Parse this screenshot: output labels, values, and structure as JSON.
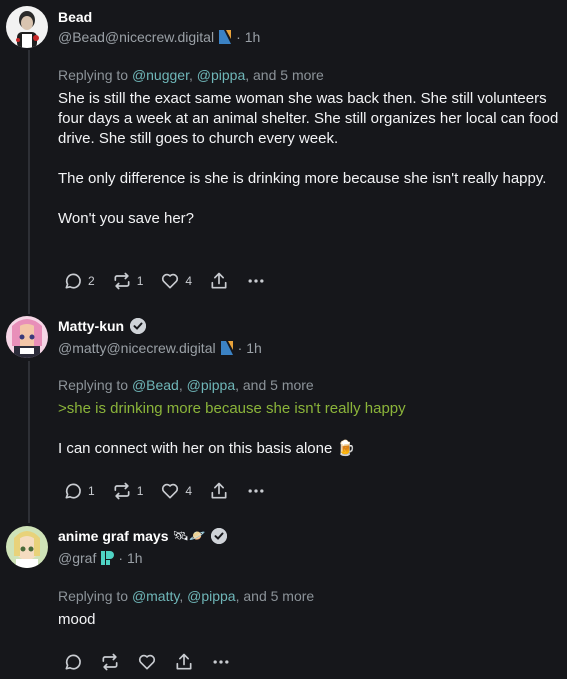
{
  "posts": [
    {
      "name": "Bead",
      "handle": "@Bead@nicecrew.digital",
      "time": "1h",
      "separator": "·",
      "replying_prefix": "Replying to",
      "mentions": [
        "@nugger",
        "@pippa"
      ],
      "replying_more": ", and 5 more",
      "paragraphs": [
        "She is still the exact same woman she was back then. She still volunteers four days a week at an animal shelter. She still organizes her local can food drive. She still goes to church every week.",
        "The only difference is she is drinking more because she isn't really happy.",
        "Won't you save her?"
      ],
      "counts": {
        "replies": "2",
        "reposts": "1",
        "likes": "4"
      },
      "instance_icon": "nicecrew-n-icon"
    },
    {
      "name": "Matty-kun",
      "handle": "@matty@nicecrew.digital",
      "time": "1h",
      "separator": "·",
      "replying_prefix": "Replying to",
      "mentions": [
        "@Bead",
        "@pippa"
      ],
      "replying_more": ", and 5 more",
      "greentext": ">she is drinking more because she isn't really happy",
      "text": "I can connect with her on this basis alone",
      "emoji": "🍺",
      "counts": {
        "replies": "1",
        "reposts": "1",
        "likes": "4"
      },
      "instance_icon": "nicecrew-n-icon",
      "verified": true
    },
    {
      "name": "anime graf mays",
      "name_emoji": "🛰🪐",
      "handle": "@graf",
      "time": "1h",
      "separator": "·",
      "replying_prefix": "Replying to",
      "mentions": [
        "@matty",
        "@pippa"
      ],
      "replying_more": ", and 5 more",
      "text": "mood",
      "instance_icon": "pleroma-p-icon",
      "verified": true
    }
  ],
  "colors": {
    "background": "#16171b",
    "mention": "#6fb6b8",
    "greentext": "#8bb43a",
    "muted": "#9aa0a6"
  }
}
